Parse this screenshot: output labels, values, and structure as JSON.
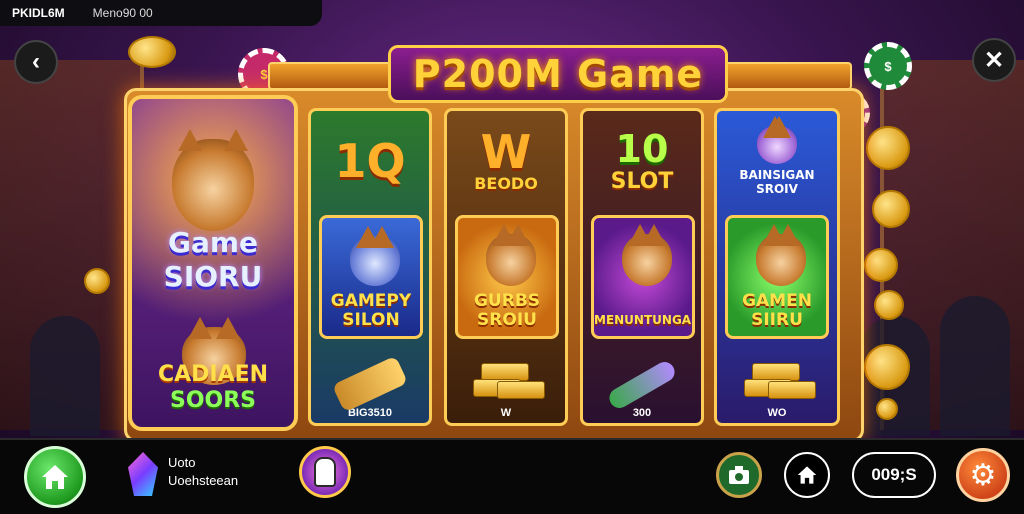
{
  "status_bar": {
    "left": "PKIDL6M",
    "right": "Meno90 00"
  },
  "title": "P200M Game",
  "side_panel": {
    "title": "Game SIORU",
    "sub_line1": "CADIAEN",
    "sub_line2": "SOORS"
  },
  "columns": [
    {
      "top": "1Q",
      "top_sub": "",
      "card_label": "GAMEPY SILON",
      "bottom_label": "BIG3510",
      "item": "bullets"
    },
    {
      "top": "W",
      "top_sub": "BEODO",
      "card_label": "GURBS SROIU",
      "bottom_label": "W",
      "item": "gold"
    },
    {
      "top": "10",
      "top_sub": "SLOT",
      "card_label": "MENUNTUNGAN",
      "bottom_label": "300",
      "item": "bullet"
    },
    {
      "top": "",
      "top_sub": "BAINSIGAN SROIV",
      "card_label": "GAMEN SIIRU",
      "bottom_label": "WO",
      "item": "gold"
    }
  ],
  "bottom_bar": {
    "profile_line1": "Uoto",
    "profile_line2": "Uoehsteean",
    "score": "009;S"
  },
  "icons": {
    "back": "back-icon",
    "close": "close-icon",
    "home": "home-icon",
    "camera": "camera-icon",
    "settings": "gear-icon",
    "gem": "gem-icon"
  },
  "colors": {
    "accent_gold": "#ffcc55",
    "home_green": "#1f9a1f",
    "settings_orange": "#e0561a",
    "title_gold": "#ffd23a"
  }
}
